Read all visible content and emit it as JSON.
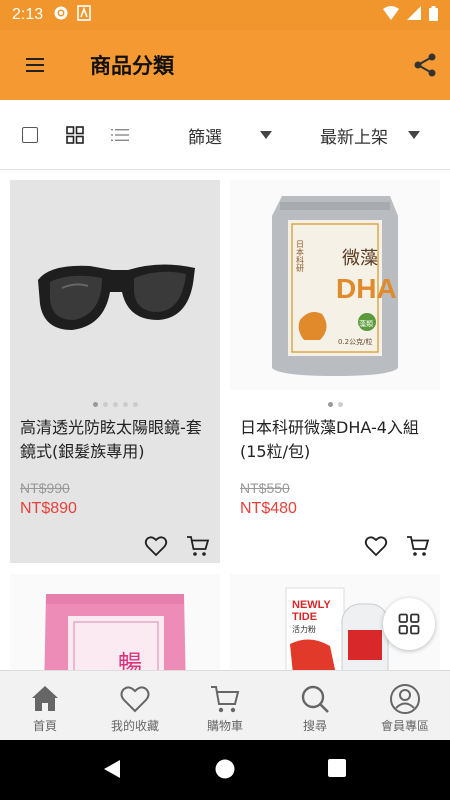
{
  "status_bar": {
    "time": "2:13"
  },
  "app_bar": {
    "title": "商品分類"
  },
  "toolbar": {
    "filter_label": "篩選",
    "sort_label": "最新上架"
  },
  "products": [
    {
      "name": "高清透光防眩太陽眼鏡-套鏡式(銀髮族專用)",
      "original_price": "NT$990",
      "price": "NT$890"
    },
    {
      "name": "日本科研微藻DHA-4入組(15粒/包)",
      "original_price": "NT$550",
      "price": "NT$480"
    }
  ],
  "product_images": {
    "dha_pack": {
      "left_text": "日本科研",
      "title": "微藻",
      "brand": "DHA",
      "badge": "藻類",
      "bottom": "0.2公克/粒"
    },
    "pink_pack": {
      "text": "暢"
    },
    "bottle": {
      "brand_line1": "NEWLY",
      "brand_line2": "TIDE",
      "tag": "活力粉"
    }
  },
  "bottom_nav": [
    {
      "label": "首頁",
      "icon": "home-icon"
    },
    {
      "label": "我的收藏",
      "icon": "heart-icon"
    },
    {
      "label": "購物車",
      "icon": "cart-icon"
    },
    {
      "label": "搜尋",
      "icon": "search-icon"
    },
    {
      "label": "會員專區",
      "icon": "user-icon"
    }
  ],
  "colors": {
    "app_bar": "#f59a33",
    "status_bar": "#f0962c",
    "price": "#e8403a"
  }
}
